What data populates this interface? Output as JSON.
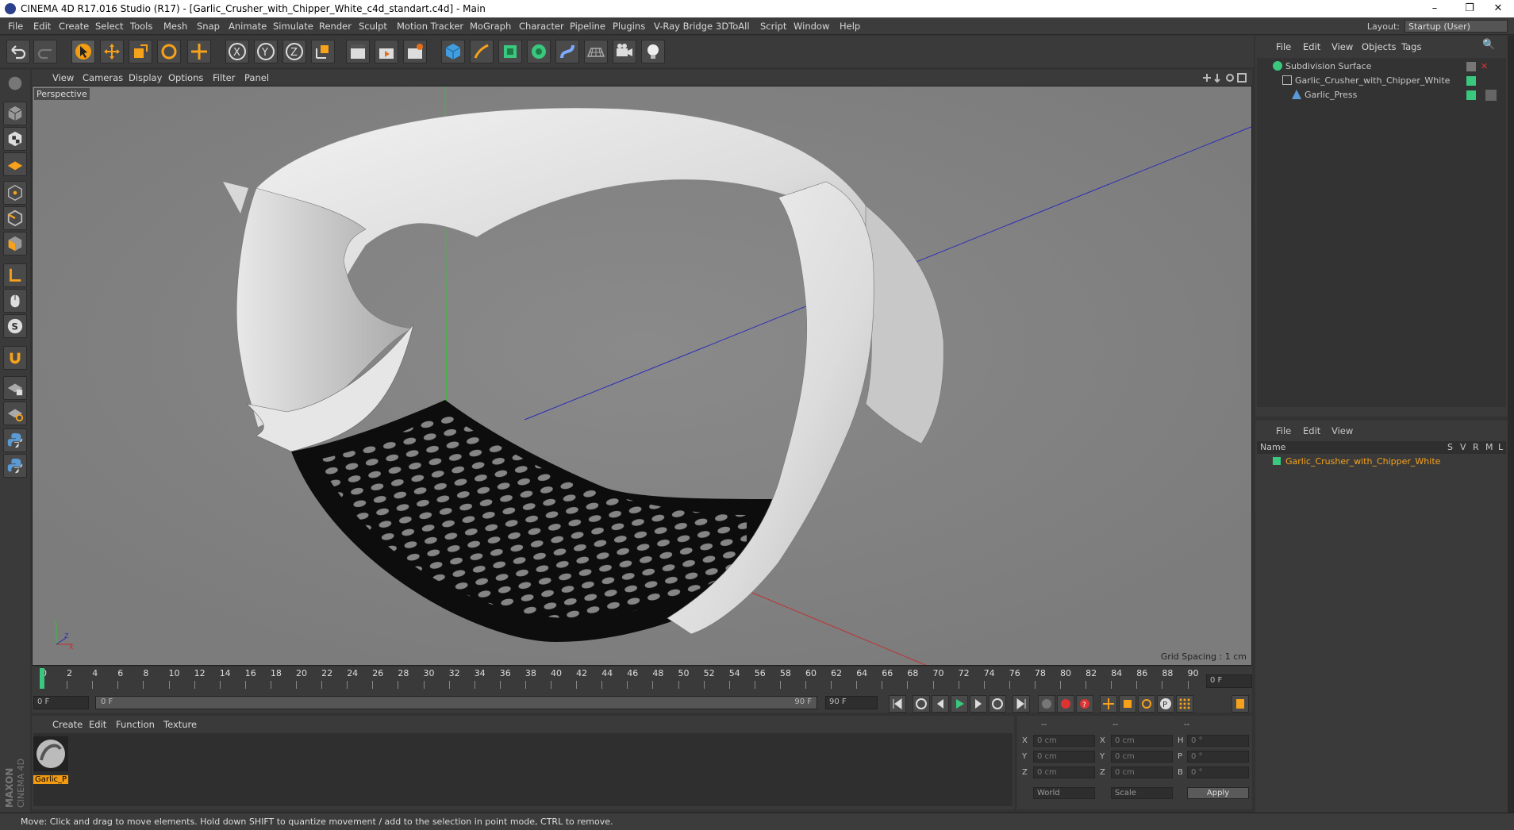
{
  "window": {
    "title": "CINEMA 4D R17.016 Studio (R17) - [Garlic_Crusher_with_Chipper_White_c4d_standart.c4d] - Main"
  },
  "menubar": {
    "items": [
      "File",
      "Edit",
      "Create",
      "Select",
      "Tools",
      "Mesh",
      "Snap",
      "Animate",
      "Simulate",
      "Render",
      "Sculpt",
      "Motion Tracker",
      "MoGraph",
      "Character",
      "Pipeline",
      "Plugins",
      "V-Ray Bridge",
      "3DToAll",
      "Script",
      "Window",
      "Help"
    ],
    "layout_label": "Layout:",
    "layout_value": "Startup (User)"
  },
  "viewport": {
    "menu": [
      "View",
      "Cameras",
      "Display",
      "Options",
      "Filter",
      "Panel"
    ],
    "camera_label": "Perspective",
    "grid_spacing": "Grid Spacing : 1 cm"
  },
  "timeline": {
    "ticks": [
      "0",
      "2",
      "4",
      "6",
      "8",
      "10",
      "12",
      "14",
      "16",
      "18",
      "20",
      "22",
      "24",
      "26",
      "28",
      "30",
      "32",
      "34",
      "36",
      "38",
      "40",
      "42",
      "44",
      "46",
      "48",
      "50",
      "52",
      "54",
      "56",
      "58",
      "60",
      "62",
      "64",
      "66",
      "68",
      "70",
      "72",
      "74",
      "76",
      "78",
      "80",
      "82",
      "84",
      "86",
      "88",
      "90"
    ],
    "current_frame": "0 F",
    "start_field": "0 F",
    "range_start": "0 F",
    "range_end": "90 F",
    "end_field": "90 F"
  },
  "material_panel": {
    "menu": [
      "Create",
      "Edit",
      "Function",
      "Texture"
    ],
    "material_label": "Garlic_P"
  },
  "coords": {
    "headers": [
      "--",
      "--",
      "--"
    ],
    "rows": [
      {
        "a": "X",
        "av": "0 cm",
        "b": "X",
        "bv": "0 cm",
        "c": "H",
        "cv": "0 °"
      },
      {
        "a": "Y",
        "av": "0 cm",
        "b": "Y",
        "bv": "0 cm",
        "c": "P",
        "cv": "0 °"
      },
      {
        "a": "Z",
        "av": "0 cm",
        "b": "Z",
        "bv": "0 cm",
        "c": "B",
        "cv": "0 °"
      }
    ],
    "mode1": "World",
    "mode2": "Scale",
    "apply": "Apply"
  },
  "object_manager": {
    "menu": [
      "File",
      "Edit",
      "View",
      "Objects",
      "Tags"
    ],
    "objects": [
      "Subdivision Surface",
      "Garlic_Crusher_with_Chipper_White",
      "Garlic_Press"
    ]
  },
  "attr_manager": {
    "menu": [
      "File",
      "Edit",
      "View"
    ],
    "col_name": "Name",
    "cols": [
      "S",
      "V",
      "R",
      "M",
      "L"
    ],
    "item": "Garlic_Crusher_with_Chipper_White"
  },
  "status": "Move: Click and drag to move elements. Hold down SHIFT to quantize movement / add to the selection in point mode, CTRL to remove.",
  "colors": {
    "accent": "#f7a21b",
    "green_tag": "#3ac77e",
    "active_orange": "#f39c12"
  },
  "brand": "MAXON CINEMA 4D"
}
